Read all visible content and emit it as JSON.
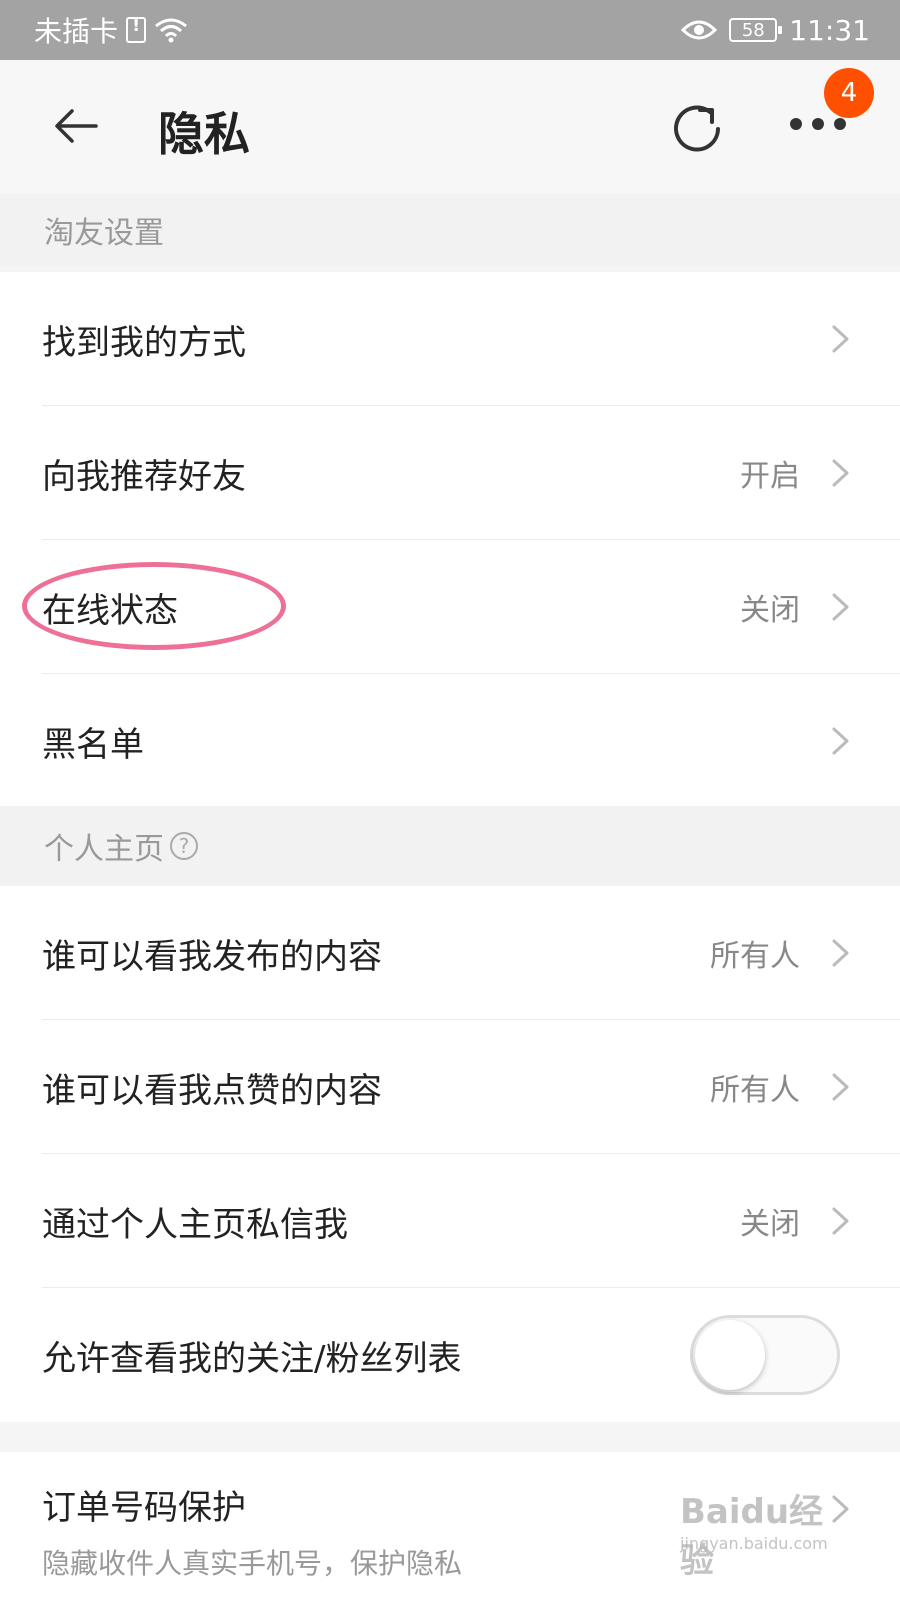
{
  "status_bar": {
    "carrier": "未插卡",
    "battery": "58",
    "time": "11:31"
  },
  "header": {
    "title": "隐私",
    "badge_count": "4"
  },
  "sections": {
    "taoyou": {
      "label": "淘友设置",
      "rows": [
        {
          "label": "找到我的方式",
          "value": ""
        },
        {
          "label": "向我推荐好友",
          "value": "开启"
        },
        {
          "label": "在线状态",
          "value": "关闭"
        },
        {
          "label": "黑名单",
          "value": ""
        }
      ]
    },
    "homepage": {
      "label": "个人主页",
      "help": "?",
      "rows": [
        {
          "label": "谁可以看我发布的内容",
          "value": "所有人"
        },
        {
          "label": "谁可以看我点赞的内容",
          "value": "所有人"
        },
        {
          "label": "通过个人主页私信我",
          "value": "关闭"
        },
        {
          "label": "允许查看我的关注/粉丝列表",
          "toggle_on": false
        }
      ]
    },
    "order": {
      "label": "订单号码保护",
      "subtitle": "隐藏收件人真实手机号，保护隐私"
    }
  },
  "watermark": {
    "main": "Baidu经验",
    "sub": "jingyan.baidu.com"
  },
  "colors": {
    "accent": "#ff5000",
    "highlight": "#ee7096"
  }
}
